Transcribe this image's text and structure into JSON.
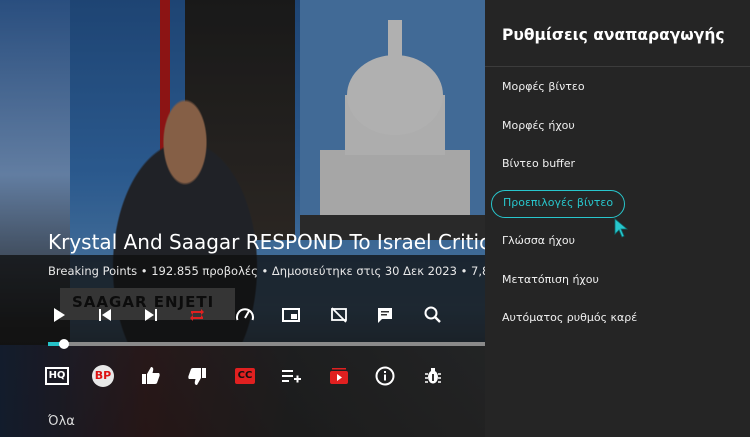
{
  "video": {
    "title": "Krystal And Saagar RESPOND To Israel Critic",
    "meta": "Breaking Points • 192.855 προβολές • Δημοσιεύτηκε στις 30 Δεκ 2023 • 7,8",
    "lower_third_text": "SAAGAR ENJETI",
    "progress_fraction": 0.036,
    "footer_label": "Όλα"
  },
  "controls": [
    {
      "name": "play-icon"
    },
    {
      "name": "previous-icon"
    },
    {
      "name": "next-icon"
    },
    {
      "name": "repeat-icon",
      "color": "#e02020"
    },
    {
      "name": "speed-icon"
    },
    {
      "name": "picture-in-picture-icon"
    },
    {
      "name": "cast-off-icon"
    },
    {
      "name": "chat-icon"
    },
    {
      "name": "search-icon"
    }
  ],
  "actions": {
    "hq_label": "HQ",
    "channel_label": "BP",
    "cc_label": "CC",
    "items": [
      "hq-icon",
      "channel-avatar",
      "like-icon",
      "dislike-icon",
      "captions-icon",
      "add-to-playlist-icon",
      "subscribe-icon",
      "info-icon",
      "debug-icon"
    ]
  },
  "settings": {
    "title": "Ρυθμίσεις αναπαραγωγής",
    "items": [
      {
        "label": "Μορφές βίντεο",
        "selected": false
      },
      {
        "label": "Μορφές ήχου",
        "selected": false
      },
      {
        "label": "Βίντεο buffer",
        "selected": false
      },
      {
        "label": "Προεπιλογές βίντεο",
        "selected": true
      },
      {
        "label": "Γλώσσα ήχου",
        "selected": false
      },
      {
        "label": "Μετατόπιση ήχου",
        "selected": false
      },
      {
        "label": "Αυτόματος ρυθμός καρέ",
        "selected": false
      }
    ]
  },
  "colors": {
    "accent": "#28c6cc",
    "progress": "#25c2c9",
    "red": "#e02020",
    "panel": "#252525"
  }
}
